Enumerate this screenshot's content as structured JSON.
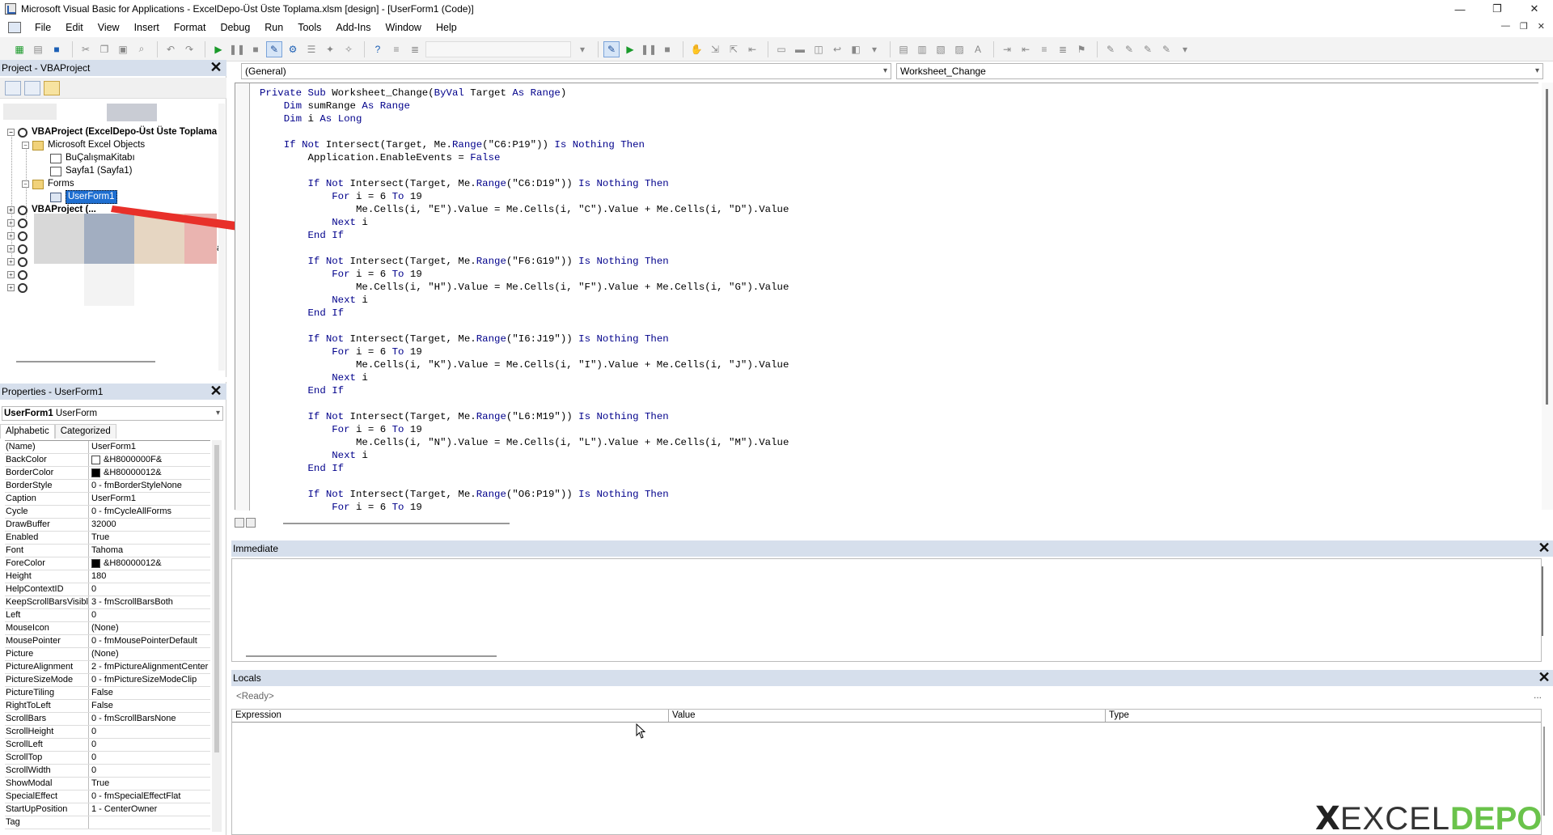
{
  "window": {
    "title": "Microsoft Visual Basic for Applications - ExcelDepo-Üst Üste Toplama.xlsm [design] - [UserForm1 (Code)]",
    "controls": [
      "—",
      "❐",
      "✕"
    ]
  },
  "menu": {
    "items": [
      "File",
      "Edit",
      "View",
      "Insert",
      "Format",
      "Debug",
      "Run",
      "Tools",
      "Add-Ins",
      "Window",
      "Help"
    ],
    "mdi_controls": [
      "—",
      "❐",
      "✕"
    ]
  },
  "project": {
    "title": "Project - VBAProject",
    "close": "✕",
    "tree": {
      "root": "VBAProject (ExcelDepo-Üst Üste Toplama",
      "excel_objects": "Microsoft Excel Objects",
      "workbook": "BuÇalışmaKitabı",
      "sheet1": "Sayfa1 (Sayfa1)",
      "forms": "Forms",
      "userform": "UserForm1",
      "other_project": "VBAProject (...",
      "partial_suffix": "a("
    }
  },
  "properties": {
    "title": "Properties - UserForm1",
    "close": "✕",
    "object_name": "UserForm1",
    "object_type": "UserForm",
    "tabs": [
      "Alphabetic",
      "Categorized"
    ],
    "rows": [
      {
        "k": "(Name)",
        "v": "UserForm1"
      },
      {
        "k": "BackColor",
        "v": "&H8000000F&",
        "swatch": "#ffffff"
      },
      {
        "k": "BorderColor",
        "v": "&H80000012&",
        "swatch": "#000000"
      },
      {
        "k": "BorderStyle",
        "v": "0 - fmBorderStyleNone"
      },
      {
        "k": "Caption",
        "v": "UserForm1"
      },
      {
        "k": "Cycle",
        "v": "0 - fmCycleAllForms"
      },
      {
        "k": "DrawBuffer",
        "v": "32000"
      },
      {
        "k": "Enabled",
        "v": "True"
      },
      {
        "k": "Font",
        "v": "Tahoma"
      },
      {
        "k": "ForeColor",
        "v": "&H80000012&",
        "swatch": "#000000"
      },
      {
        "k": "Height",
        "v": "180"
      },
      {
        "k": "HelpContextID",
        "v": "0"
      },
      {
        "k": "KeepScrollBarsVisible",
        "v": "3 - fmScrollBarsBoth"
      },
      {
        "k": "Left",
        "v": "0"
      },
      {
        "k": "MouseIcon",
        "v": "(None)"
      },
      {
        "k": "MousePointer",
        "v": "0 - fmMousePointerDefault"
      },
      {
        "k": "Picture",
        "v": "(None)"
      },
      {
        "k": "PictureAlignment",
        "v": "2 - fmPictureAlignmentCenter"
      },
      {
        "k": "PictureSizeMode",
        "v": "0 - fmPictureSizeModeClip"
      },
      {
        "k": "PictureTiling",
        "v": "False"
      },
      {
        "k": "RightToLeft",
        "v": "False"
      },
      {
        "k": "ScrollBars",
        "v": "0 - fmScrollBarsNone"
      },
      {
        "k": "ScrollHeight",
        "v": "0"
      },
      {
        "k": "ScrollLeft",
        "v": "0"
      },
      {
        "k": "ScrollTop",
        "v": "0"
      },
      {
        "k": "ScrollWidth",
        "v": "0"
      },
      {
        "k": "ShowModal",
        "v": "True"
      },
      {
        "k": "SpecialEffect",
        "v": "0 - fmSpecialEffectFlat"
      },
      {
        "k": "StartUpPosition",
        "v": "1 - CenterOwner"
      },
      {
        "k": "Tag",
        "v": ""
      }
    ]
  },
  "code": {
    "object_combo": "(General)",
    "proc_combo": "Worksheet_Change",
    "lines": [
      "Private Sub Worksheet_Change(ByVal Target As Range)",
      "    Dim sumRange As Range",
      "    Dim i As Long",
      "",
      "    If Not Intersect(Target, Me.Range(\"C6:P19\")) Is Nothing Then",
      "        Application.EnableEvents = False",
      "",
      "        If Not Intersect(Target, Me.Range(\"C6:D19\")) Is Nothing Then",
      "            For i = 6 To 19",
      "                Me.Cells(i, \"E\").Value = Me.Cells(i, \"C\").Value + Me.Cells(i, \"D\").Value",
      "            Next i",
      "        End If",
      "",
      "        If Not Intersect(Target, Me.Range(\"F6:G19\")) Is Nothing Then",
      "            For i = 6 To 19",
      "                Me.Cells(i, \"H\").Value = Me.Cells(i, \"F\").Value + Me.Cells(i, \"G\").Value",
      "            Next i",
      "        End If",
      "",
      "        If Not Intersect(Target, Me.Range(\"I6:J19\")) Is Nothing Then",
      "            For i = 6 To 19",
      "                Me.Cells(i, \"K\").Value = Me.Cells(i, \"I\").Value + Me.Cells(i, \"J\").Value",
      "            Next i",
      "        End If",
      "",
      "        If Not Intersect(Target, Me.Range(\"L6:M19\")) Is Nothing Then",
      "            For i = 6 To 19",
      "                Me.Cells(i, \"N\").Value = Me.Cells(i, \"L\").Value + Me.Cells(i, \"M\").Value",
      "            Next i",
      "        End If",
      "",
      "        If Not Intersect(Target, Me.Range(\"O6:P19\")) Is Nothing Then",
      "            For i = 6 To 19"
    ]
  },
  "immediate": {
    "title": "Immediate",
    "close": "✕"
  },
  "locals": {
    "title": "Locals",
    "close": "✕",
    "status": "<Ready>",
    "more": "...",
    "columns": [
      "Expression",
      "Value",
      "Type"
    ]
  },
  "watermark": {
    "mark": "X",
    "text_a": "EXCEL",
    "text_b": "DEPO"
  },
  "colors": {
    "keyword": "#00008b",
    "pane_title": "#d6dfec",
    "selection": "#1f6fd1",
    "arrow": "#e8302a",
    "logo_green": "#6ac34b"
  }
}
